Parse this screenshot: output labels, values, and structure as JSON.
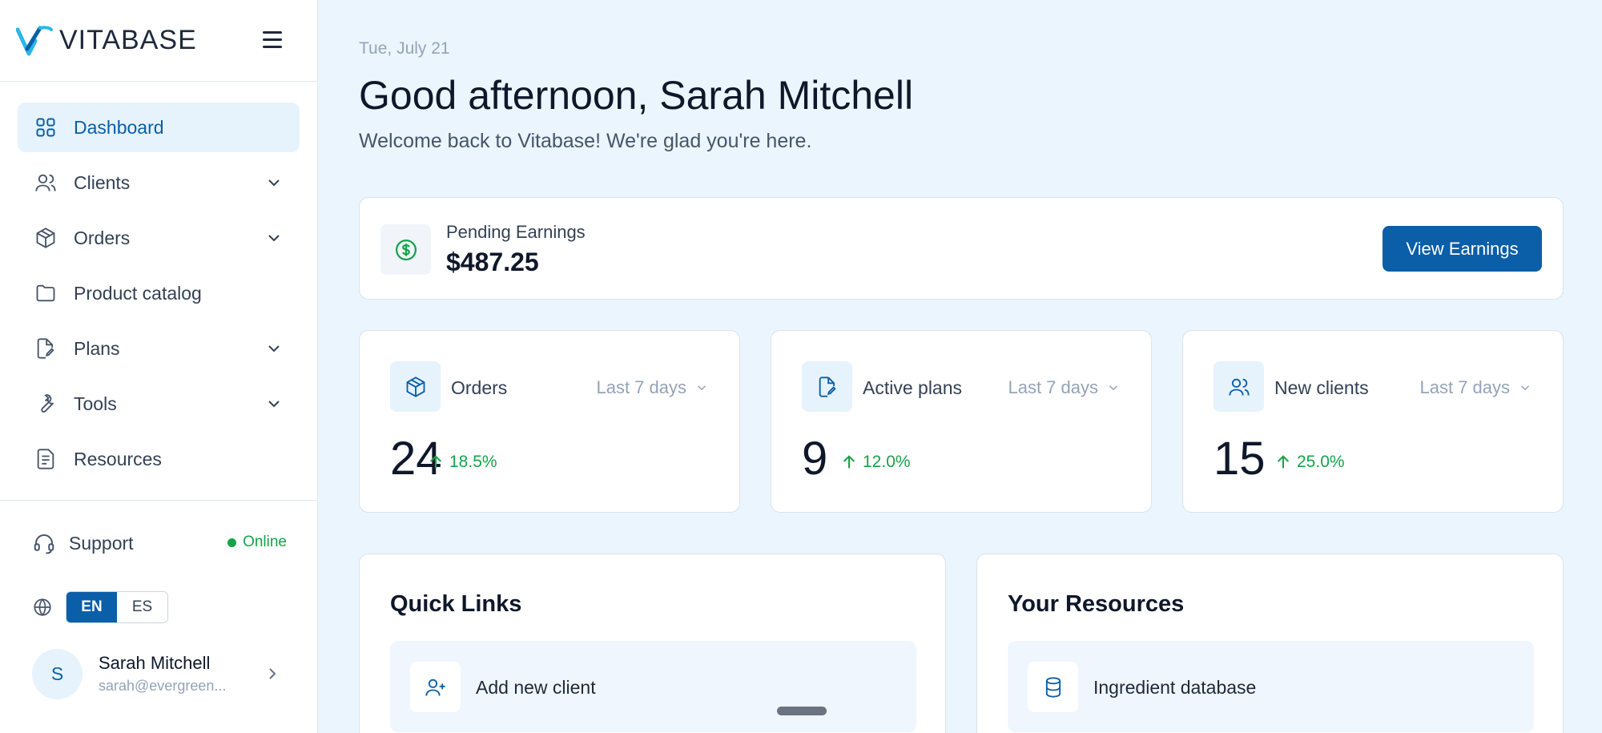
{
  "brand": {
    "name": "VITABASE"
  },
  "sidebar": {
    "items": [
      {
        "label": "Dashboard",
        "icon": "dashboard-grid-icon",
        "active": true,
        "expandable": false
      },
      {
        "label": "Clients",
        "icon": "users-icon",
        "active": false,
        "expandable": true
      },
      {
        "label": "Orders",
        "icon": "package-icon",
        "active": false,
        "expandable": true
      },
      {
        "label": "Product catalog",
        "icon": "folder-icon",
        "active": false,
        "expandable": false
      },
      {
        "label": "Plans",
        "icon": "file-edit-icon",
        "active": false,
        "expandable": true
      },
      {
        "label": "Tools",
        "icon": "wrench-icon",
        "active": false,
        "expandable": true
      },
      {
        "label": "Resources",
        "icon": "document-icon",
        "active": false,
        "expandable": false
      }
    ],
    "support": {
      "label": "Support",
      "status": "Online"
    },
    "language": {
      "options": [
        "EN",
        "ES"
      ],
      "selected": "EN"
    },
    "user": {
      "initial": "S",
      "name": "Sarah Mitchell",
      "email": "sarah@evergreen..."
    }
  },
  "main": {
    "date": "Tue, July 21",
    "greeting": "Good afternoon, Sarah Mitchell",
    "welcome": "Welcome back to Vitabase! We're glad you're here.",
    "earnings": {
      "label": "Pending Earnings",
      "value": "$487.25",
      "button": "View Earnings"
    },
    "stats": [
      {
        "title": "Orders",
        "period": "Last 7 days",
        "value": "24",
        "change": "18.5%",
        "icon": "package-icon"
      },
      {
        "title": "Active plans",
        "period": "Last 7 days",
        "value": "9",
        "change": "12.0%",
        "icon": "file-edit-icon"
      },
      {
        "title": "New clients",
        "period": "Last 7 days",
        "value": "15",
        "change": "25.0%",
        "icon": "users-icon"
      }
    ],
    "quick_links": {
      "title": "Quick Links",
      "items": [
        {
          "label": "Add new client",
          "icon": "user-plus-icon"
        }
      ]
    },
    "resources": {
      "title": "Your Resources",
      "items": [
        {
          "label": "Ingredient database",
          "icon": "database-icon"
        }
      ]
    }
  },
  "colors": {
    "accent": "#0b5ea8",
    "positive": "#16a34a",
    "background": "#eaf5fd"
  }
}
